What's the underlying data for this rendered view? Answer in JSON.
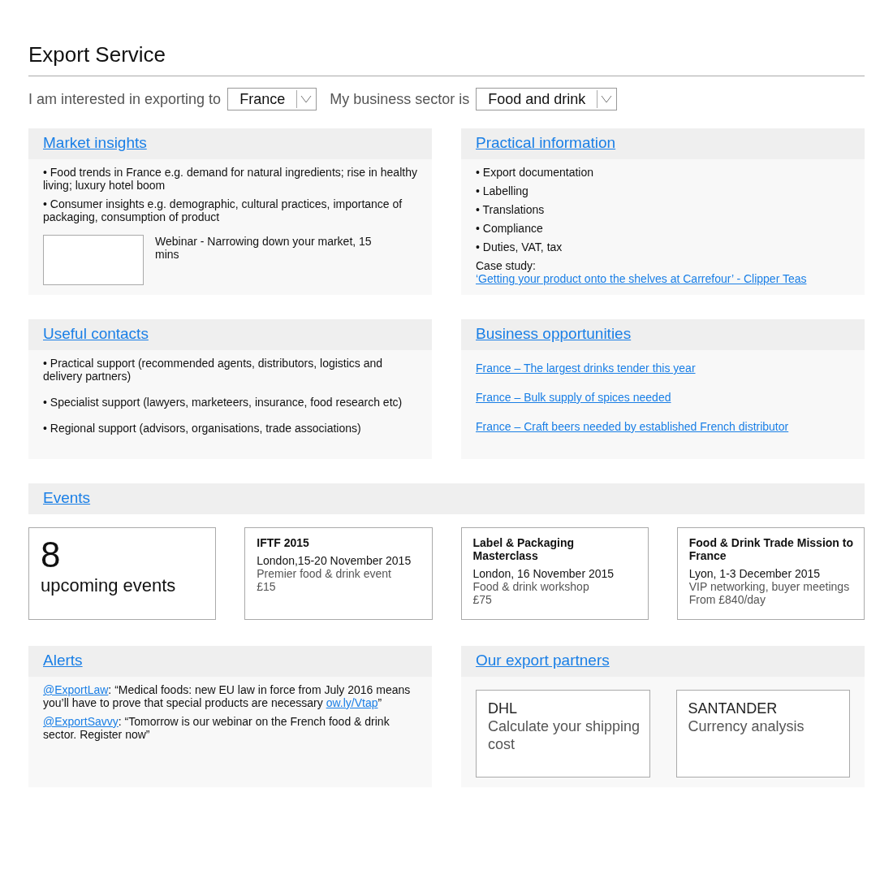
{
  "title": "Export Service",
  "filters": [
    {
      "label": "I am interested in exporting to",
      "value": "France"
    },
    {
      "label": "My business sector is",
      "value": "Food and drink"
    }
  ],
  "market_insights": {
    "heading": "Market insights",
    "bullets": [
      "• Food trends in France e.g. demand for natural ingredients; rise in healthy living; luxury hotel boom",
      "• Consumer insights e.g. demographic, cultural practices, importance of packaging, consumption of product"
    ],
    "webinar": "Webinar - Narrowing down your market, 15 mins"
  },
  "practical_information": {
    "heading": "Practical information",
    "bullets": [
      "• Export documentation",
      "• Labelling",
      "• Translations",
      "• Compliance",
      "• Duties, VAT, tax"
    ],
    "case_study_label": "Case study:",
    "case_study_link": "‘Getting your product onto the shelves at Carrefour’ - Clipper Teas"
  },
  "useful_contacts": {
    "heading": "Useful contacts",
    "bullets": [
      "• Practical support (recommended agents, distributors, logistics and delivery partners)",
      "• Specialist support (lawyers, marketeers, insurance, food research etc)",
      "• Regional support (advisors, organisations, trade associations)"
    ]
  },
  "business_opportunities": {
    "heading": "Business opportunities",
    "links": [
      "France – The largest drinks tender this year",
      "France – Bulk supply of spices needed",
      "France – Craft beers needed by established French distributor"
    ]
  },
  "events": {
    "heading": "Events",
    "count": "8",
    "count_label": "upcoming events",
    "items": [
      {
        "title": "IFTF 2015",
        "place_date": "London,15-20 November 2015",
        "description": "Premier food & drink event",
        "price": "£15"
      },
      {
        "title": "Label & Packaging Masterclass",
        "place_date": "London, 16 November 2015",
        "description": "Food & drink workshop",
        "price": "£75"
      },
      {
        "title": "Food & Drink Trade Mission to France",
        "place_date": "Lyon, 1-3 December 2015",
        "description": "VIP networking, buyer meetings",
        "price": "From £840/day"
      }
    ]
  },
  "alerts": {
    "heading": "Alerts",
    "items": [
      {
        "handle": "@ExportLaw",
        "text": ": “Medical foods: new EU law in force from July 2016 means you’ll have to prove that special products are necessary ",
        "link": "ow.ly/Vtap",
        "text_after": "”"
      },
      {
        "handle": "@ExportSavvy",
        "text": ": “Tomorrow is our webinar on the French food & drink sector. Register now”"
      }
    ]
  },
  "partners": {
    "heading": "Our export partners",
    "items": [
      {
        "name": "DHL",
        "service": "Calculate your shipping cost"
      },
      {
        "name": "SANTANDER",
        "service": "Currency analysis"
      }
    ]
  }
}
